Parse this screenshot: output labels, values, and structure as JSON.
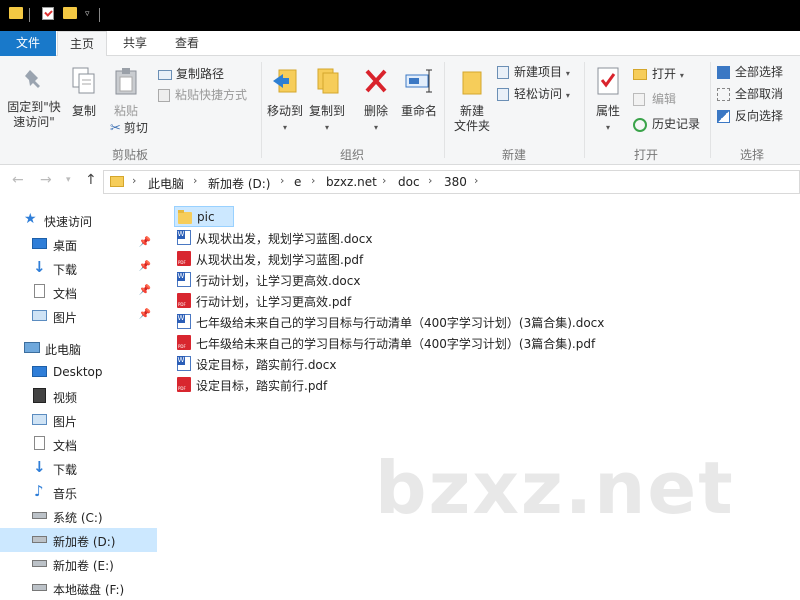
{
  "ribbon_tabs": {
    "file": "文件",
    "home": "主页",
    "share": "共享",
    "view": "查看"
  },
  "ribbon": {
    "clipboard": {
      "pin": "固定到\"快\n速访问\"",
      "pin_line1": "固定到\"快",
      "pin_line2": "速访问\"",
      "copy": "复制",
      "paste": "粘贴",
      "copy_path": "复制路径",
      "paste_shortcut": "粘贴快捷方式",
      "cut": "剪切",
      "group": "剪贴板"
    },
    "organize": {
      "move_to": "移动到",
      "copy_to": "复制到",
      "delete": "删除",
      "rename": "重命名",
      "group": "组织"
    },
    "new": {
      "new_folder_line1": "新建",
      "new_folder_line2": "文件夹",
      "new_item": "新建项目",
      "easy_access": "轻松访问",
      "group": "新建"
    },
    "open": {
      "properties": "属性",
      "open": "打开",
      "edit": "编辑",
      "history": "历史记录",
      "group": "打开"
    },
    "select": {
      "select_all": "全部选择",
      "select_none": "全部取消",
      "invert": "反向选择",
      "group": "选择"
    }
  },
  "address": {
    "crumbs": [
      "此电脑",
      "新加卷 (D:)",
      "e",
      "bzxz.net",
      "doc",
      "380"
    ]
  },
  "sidebar": {
    "quick_access": "快速访问",
    "quick_items": [
      "桌面",
      "下载",
      "文档",
      "图片"
    ],
    "this_pc": "此电脑",
    "pc_items": [
      "Desktop",
      "视频",
      "图片",
      "文档",
      "下载",
      "音乐",
      "系统 (C:)",
      "新加卷 (D:)",
      "新加卷 (E:)",
      "本地磁盘 (F:)"
    ]
  },
  "files": [
    {
      "name": "pic",
      "type": "folder"
    },
    {
      "name": "从现状出发，规划学习蓝图.docx",
      "type": "word"
    },
    {
      "name": "从现状出发，规划学习蓝图.pdf",
      "type": "pdf"
    },
    {
      "name": "行动计划，让学习更高效.docx",
      "type": "word"
    },
    {
      "name": "行动计划，让学习更高效.pdf",
      "type": "pdf"
    },
    {
      "name": "七年级给未来自己的学习目标与行动清单（400字学习计划）(3篇合集).docx",
      "type": "word"
    },
    {
      "name": "七年级给未来自己的学习目标与行动清单（400字学习计划）(3篇合集).pdf",
      "type": "pdf"
    },
    {
      "name": "设定目标，踏实前行.docx",
      "type": "word"
    },
    {
      "name": "设定目标，踏实前行.pdf",
      "type": "pdf"
    }
  ],
  "watermark": "bzxz.net",
  "colors": {
    "file_tab": "#1979ca",
    "selection": "#cce8ff",
    "ribbon_bg": "#f5f6f7"
  }
}
